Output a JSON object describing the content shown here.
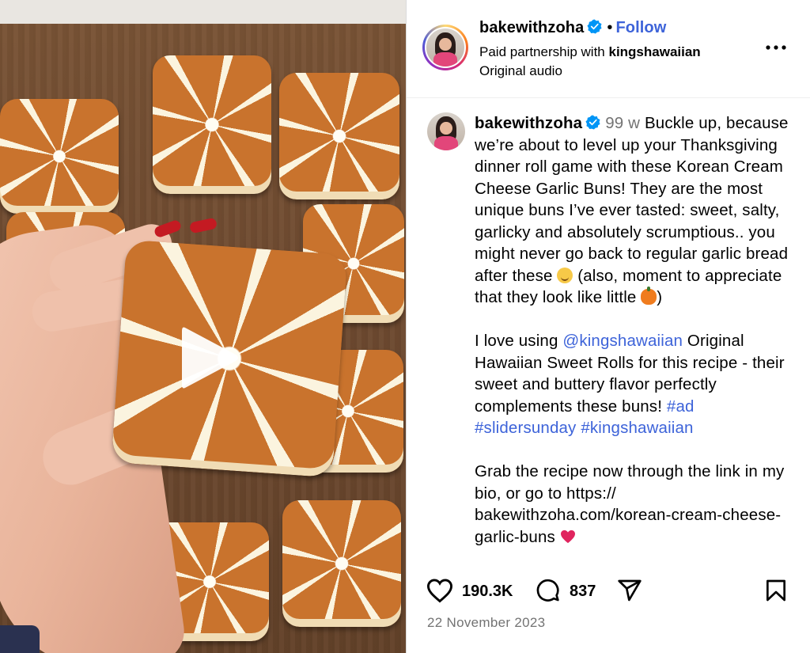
{
  "media": {
    "type": "video",
    "play_icon": "play-icon"
  },
  "header": {
    "username": "bakewithzoha",
    "separator": "•",
    "follow_label": "Follow",
    "partnership_prefix": "Paid partnership with ",
    "partner": "kingshawaiian",
    "audio": "Original audio",
    "more_icon": "more-horizontal-icon"
  },
  "caption": {
    "username": "bakewithzoha",
    "time": "99 w",
    "p1": "Buckle up, because we’re about to level up your Thanksgiving dinner roll game with these Korean Cream Cheese Garlic Buns! They are the most unique buns I’ve ever tasted: sweet, salty, garlicky and absolutely scrumptious.. you might never go back to regular garlic bread after these",
    "p1_mid": " (also, moment to appreciate that they look like little ",
    "p1_end": ")",
    "p2_a": "I love using ",
    "p2_mention": "@kingshawaiian",
    "p2_b": " Original Hawaiian Sweet Rolls for this recipe - their sweet and buttery flavor perfectly complements these buns! ",
    "p2_tag1": "#ad",
    "p2_tag2": "#slidersunday",
    "p2_tag3": "#kingshawaiian",
    "p3": "Grab the recipe now through the link in my bio, or go to https:// bakewithzoha.com/korean-cream-cheese-garlic-buns",
    "emoji1": "relieved-face-emoji",
    "emoji2": "pumpkin-emoji",
    "emoji3": "red-heart-emoji"
  },
  "actions": {
    "likes": "190.3K",
    "comments": "837",
    "like_icon": "heart-icon",
    "comment_icon": "comment-icon",
    "share_icon": "share-icon",
    "save_icon": "bookmark-icon"
  },
  "date": "22 November 2023",
  "colors": {
    "link": "#3d63d9",
    "verified": "#0095f6",
    "muted": "#737373"
  }
}
